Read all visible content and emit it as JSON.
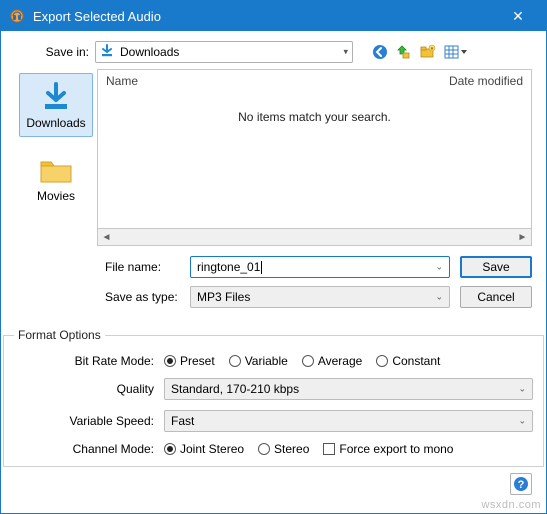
{
  "window": {
    "title": "Export Selected Audio",
    "close_glyph": "✕"
  },
  "savein": {
    "label": "Save in:",
    "value": "Downloads"
  },
  "nav": {
    "back": "back",
    "up": "up",
    "newfolder": "newfolder",
    "viewmenu": "viewmenu"
  },
  "sidebar": {
    "items": [
      {
        "label": "Downloads",
        "icon": "download"
      },
      {
        "label": "Movies",
        "icon": "folder"
      }
    ]
  },
  "filelist": {
    "columns": {
      "name": "Name",
      "date": "Date modified"
    },
    "empty": "No items match your search."
  },
  "fields": {
    "filename_label": "File name:",
    "filename_value": "ringtone_01",
    "saveastype_label": "Save as type:",
    "saveastype_value": "MP3 Files"
  },
  "buttons": {
    "save": "Save",
    "cancel": "Cancel"
  },
  "format": {
    "legend": "Format Options",
    "bitrate_label": "Bit Rate Mode:",
    "bitrate_options": [
      "Preset",
      "Variable",
      "Average",
      "Constant"
    ],
    "bitrate_selected": "Preset",
    "quality_label": "Quality",
    "quality_value": "Standard, 170-210 kbps",
    "varspeed_label": "Variable Speed:",
    "varspeed_value": "Fast",
    "channel_label": "Channel Mode:",
    "channel_options": [
      "Joint Stereo",
      "Stereo"
    ],
    "channel_selected": "Joint Stereo",
    "force_mono_label": "Force export to mono",
    "force_mono_checked": false
  },
  "help_glyph": "?",
  "watermark": "wsxdn.com"
}
